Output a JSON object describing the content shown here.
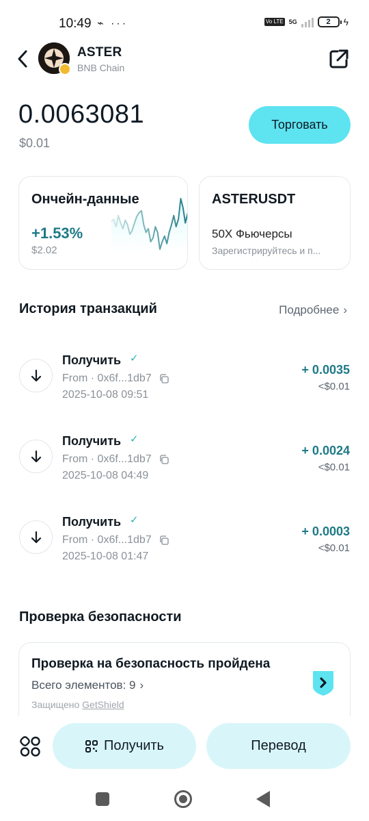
{
  "status": {
    "time": "10:49",
    "left_icons": [
      "drone-icon",
      "more-dots-icon"
    ],
    "left_icons_text": "⌁ ···",
    "volte": "Vo LTE",
    "network": "5G",
    "battery": "2"
  },
  "header": {
    "token_name": "ASTER",
    "chain": "BNB Chain"
  },
  "balance": {
    "amount": "0.0063081",
    "fiat": "$0.01",
    "trade_label": "Торговать"
  },
  "onchain_card": {
    "title": "Ончейн-данные",
    "change": "+1.53%",
    "fiat": "$2.02",
    "sparkline": [
      52,
      54,
      46,
      58,
      50,
      44,
      53,
      48,
      38,
      42,
      50,
      57,
      61,
      63,
      48,
      40,
      44,
      30,
      34,
      46,
      40,
      22,
      30,
      36,
      28,
      40,
      48,
      58,
      46,
      54,
      76,
      66,
      50,
      60,
      68
    ]
  },
  "futures_card": {
    "title": "ASTERUSDT",
    "leverage": "50X Фьючерсы",
    "subtitle": "Зарегистрируйтесь и п..."
  },
  "history": {
    "title": "История транзакций",
    "more": "Подробнее",
    "items": [
      {
        "type": "Получить",
        "from": "From · 0x6f...1db7",
        "date": "2025-10-08 09:51",
        "amount": "+ 0.0035",
        "fiat": "<$0.01"
      },
      {
        "type": "Получить",
        "from": "From · 0x6f...1db7",
        "date": "2025-10-08 04:49",
        "amount": "+ 0.0024",
        "fiat": "<$0.01"
      },
      {
        "type": "Получить",
        "from": "From · 0x6f...1db7",
        "date": "2025-10-08 01:47",
        "amount": "+ 0.0003",
        "fiat": "<$0.01"
      }
    ]
  },
  "security": {
    "section_title": "Проверка безопасности",
    "status": "Проверка на безопасность пройдена",
    "count": "Всего элементов: 9",
    "protected_by": "Защищено",
    "brand": "GetShield"
  },
  "actions": {
    "receive": "Получить",
    "transfer": "Перевод"
  },
  "colors": {
    "accent": "#5ee3f0",
    "positive": "#1d7a86",
    "action_bg": "#d8f6fa"
  }
}
